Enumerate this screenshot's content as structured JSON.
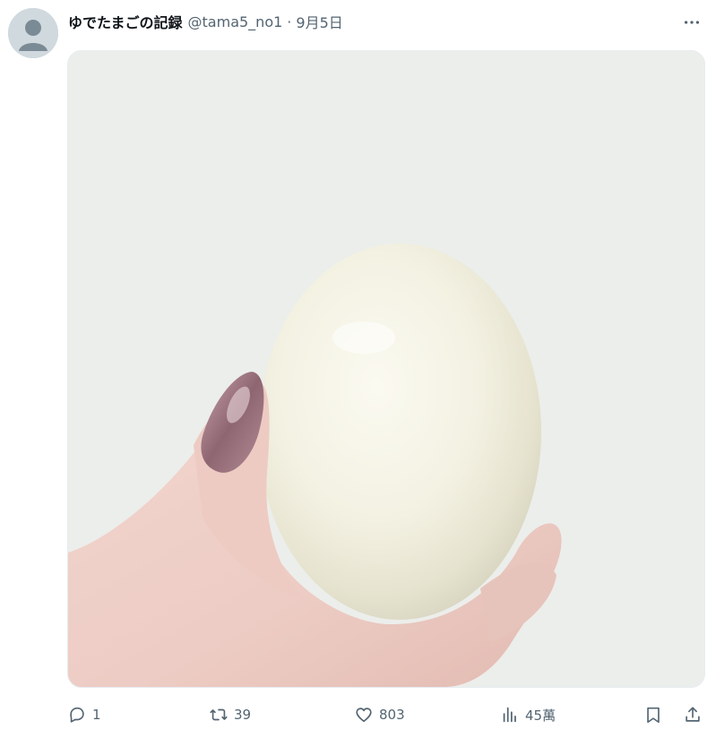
{
  "tweet": {
    "author_name": "ゆでたまごの記録",
    "handle": "@tama5_no1",
    "separator": "·",
    "date": "9月5日"
  },
  "actions": {
    "reply_count": "1",
    "retweet_count": "39",
    "like_count": "803",
    "views_count": "45萬"
  },
  "colors": {
    "secondary_text": "#536471",
    "primary_text": "#0f1419",
    "avatar_bg": "#cfd9de"
  },
  "icons": {
    "more": "more-horizontal-icon",
    "reply": "reply-icon",
    "retweet": "retweet-icon",
    "like": "heart-icon",
    "views": "views-chart-icon",
    "bookmark": "bookmark-icon",
    "share": "share-icon"
  }
}
